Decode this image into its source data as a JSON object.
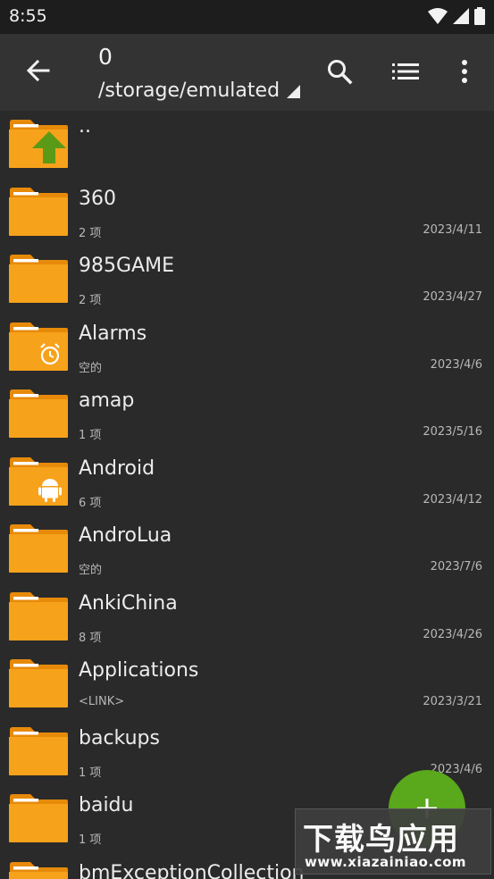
{
  "status_bar": {
    "time": "8:55",
    "icons": [
      "wifi-icon",
      "signal-icon",
      "battery-icon"
    ]
  },
  "toolbar": {
    "title": "0",
    "path": "/storage/emulated",
    "icons": [
      "back-arrow-icon",
      "search-icon",
      "list-view-icon",
      "more-vert-icon"
    ]
  },
  "files": [
    {
      "name": "..",
      "info": "",
      "date": "",
      "icon": "parent-folder-icon"
    },
    {
      "name": "360",
      "info": "2 项",
      "date": "2023/4/11",
      "icon": "folder-icon"
    },
    {
      "name": "985GAME",
      "info": "2 项",
      "date": "2023/4/27",
      "icon": "folder-icon"
    },
    {
      "name": "Alarms",
      "info": "空的",
      "date": "2023/4/6",
      "icon": "alarm-folder-icon"
    },
    {
      "name": "amap",
      "info": "1 项",
      "date": "2023/5/16",
      "icon": "folder-icon"
    },
    {
      "name": "Android",
      "info": "6 项",
      "date": "2023/4/12",
      "icon": "android-folder-icon"
    },
    {
      "name": "AndroLua",
      "info": "空的",
      "date": "2023/7/6",
      "icon": "folder-icon"
    },
    {
      "name": "AnkiChina",
      "info": "8 项",
      "date": "2023/4/26",
      "icon": "folder-icon"
    },
    {
      "name": "Applications",
      "info": "<LINK>",
      "date": "2023/3/21",
      "icon": "folder-icon"
    },
    {
      "name": "backups",
      "info": "1 项",
      "date": "2023/4/6",
      "icon": "folder-icon"
    },
    {
      "name": "baidu",
      "info": "1 项",
      "date": "",
      "icon": "folder-icon"
    },
    {
      "name": "bmExceptionCollection",
      "info": "",
      "date": "",
      "icon": "folder-icon"
    }
  ],
  "fab": {
    "icon": "add-icon"
  },
  "watermark": {
    "title": "下载鸟应用",
    "url": "www.xiazainiao.com"
  },
  "colors": {
    "folder": "#f7a21b",
    "folder_tab": "#e78a0a",
    "fab": "#5aa81c",
    "background": "#2a2a2a",
    "toolbar": "#333333"
  }
}
